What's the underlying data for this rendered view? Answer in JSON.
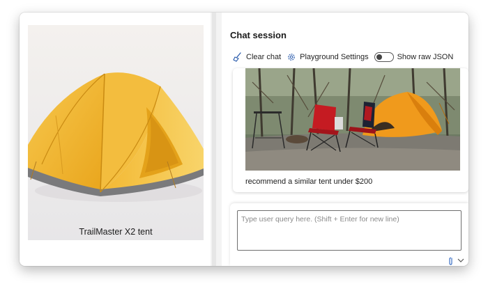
{
  "product": {
    "caption": "TrailMaster X2 tent",
    "image_icon": "yellow-dome-tent-image"
  },
  "chat": {
    "title": "Chat session",
    "toolbar": {
      "clear_label": "Clear chat",
      "clear_icon": "broom-icon",
      "settings_label": "Playground Settings",
      "settings_icon": "gear-icon",
      "raw_json_label": "Show raw JSON",
      "raw_json_on": false
    },
    "messages": [
      {
        "image_icon": "campsite-photo",
        "text": "recommend a similar tent under $200"
      }
    ],
    "composer": {
      "placeholder": "Type user query here. (Shift + Enter for new line)",
      "value": "",
      "attach_icon": "paperclip-icon",
      "options_icon": "chevron-down-icon"
    }
  }
}
